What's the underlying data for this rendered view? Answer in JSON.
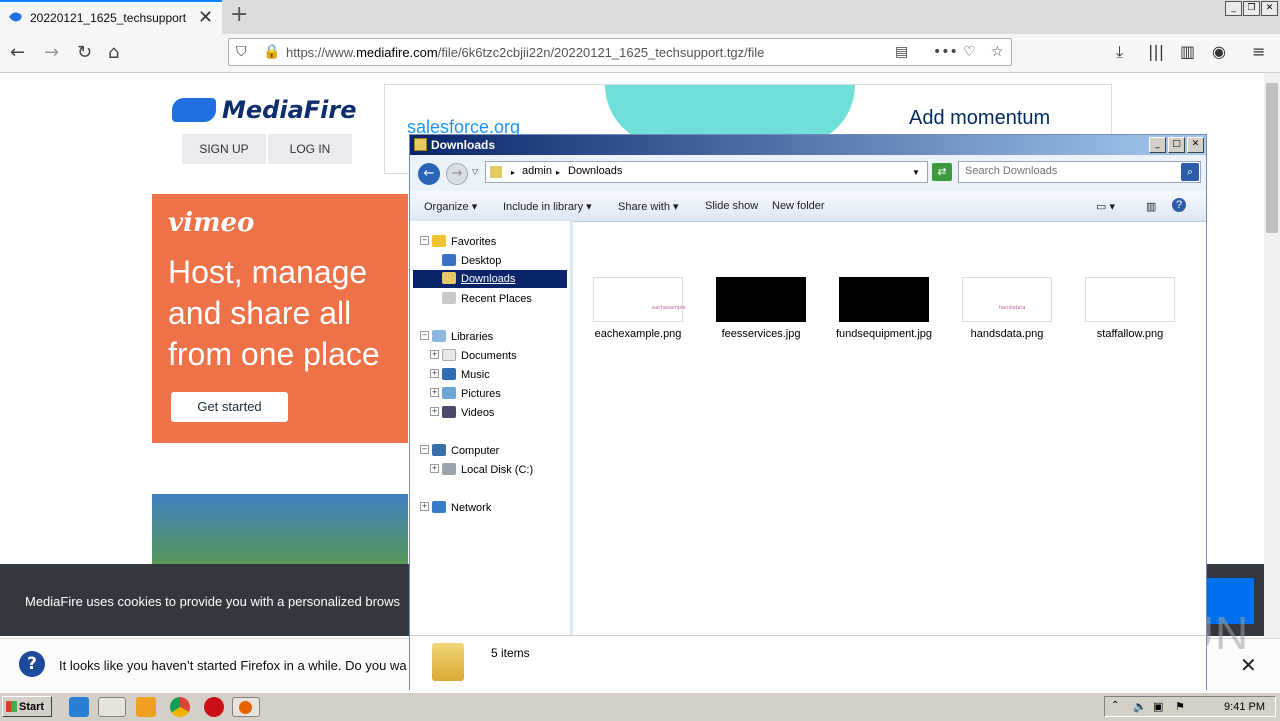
{
  "browser": {
    "tab_title": "20220121_1625_techsupport",
    "tab_close": "✕",
    "new_tab": "+",
    "url_prefix": "https://www.",
    "url_domain": "mediafire.com",
    "url_rest": "/file/6k6tzc2cbjii22n/20220121_1625_techsupport.tgz/file"
  },
  "mediafire": {
    "logo_text": "MediaFire",
    "signup": "SIGN UP",
    "login": "LOG IN"
  },
  "ad_top": {
    "brand": "salesforce.org",
    "headline": "Add momentum"
  },
  "vimeo_ad": {
    "logo": "vimeo",
    "headline": "Host, manage\nand share all\nfrom one place",
    "button": "Get started"
  },
  "cookie_banner": {
    "text": "MediaFire uses cookies to provide you with a personalized brows"
  },
  "notification": {
    "text": "It looks like you haven’t started Firefox in a while. Do you wa",
    "close": "✕"
  },
  "watermark": "ANY RUN",
  "explorer": {
    "title": "Downloads",
    "path": [
      "admin",
      "Downloads"
    ],
    "search_placeholder": "Search Downloads",
    "commands": [
      "Organize",
      "Include in library",
      "Share with",
      "Slide show",
      "New folder"
    ],
    "nav": {
      "favorites": "Favorites",
      "desktop": "Desktop",
      "downloads": "Downloads",
      "recent": "Recent Places",
      "libraries": "Libraries",
      "documents": "Documents",
      "music": "Music",
      "pictures": "Pictures",
      "videos": "Videos",
      "computer": "Computer",
      "local_disk": "Local Disk (C:)",
      "network": "Network"
    },
    "files": [
      {
        "name": "eachexample.png",
        "thumb_bg": "#ffffff",
        "thumb_text": "eachexample"
      },
      {
        "name": "feesservices.jpg",
        "thumb_bg": "#000000",
        "thumb_text": ""
      },
      {
        "name": "fundsequipment.jpg",
        "thumb_bg": "#000000",
        "thumb_text": ""
      },
      {
        "name": "handsdata.png",
        "thumb_bg": "#ffffff",
        "thumb_text": "handsdata"
      },
      {
        "name": "staffallow.png",
        "thumb_bg": "#ffffff",
        "thumb_text": ""
      }
    ],
    "status": "5 items"
  },
  "taskbar": {
    "start": "Start",
    "clock": "9:41 PM"
  },
  "colors": {
    "accent": "#0a84ff",
    "vimeo": "#ef7147",
    "selection": "#0a246a"
  }
}
